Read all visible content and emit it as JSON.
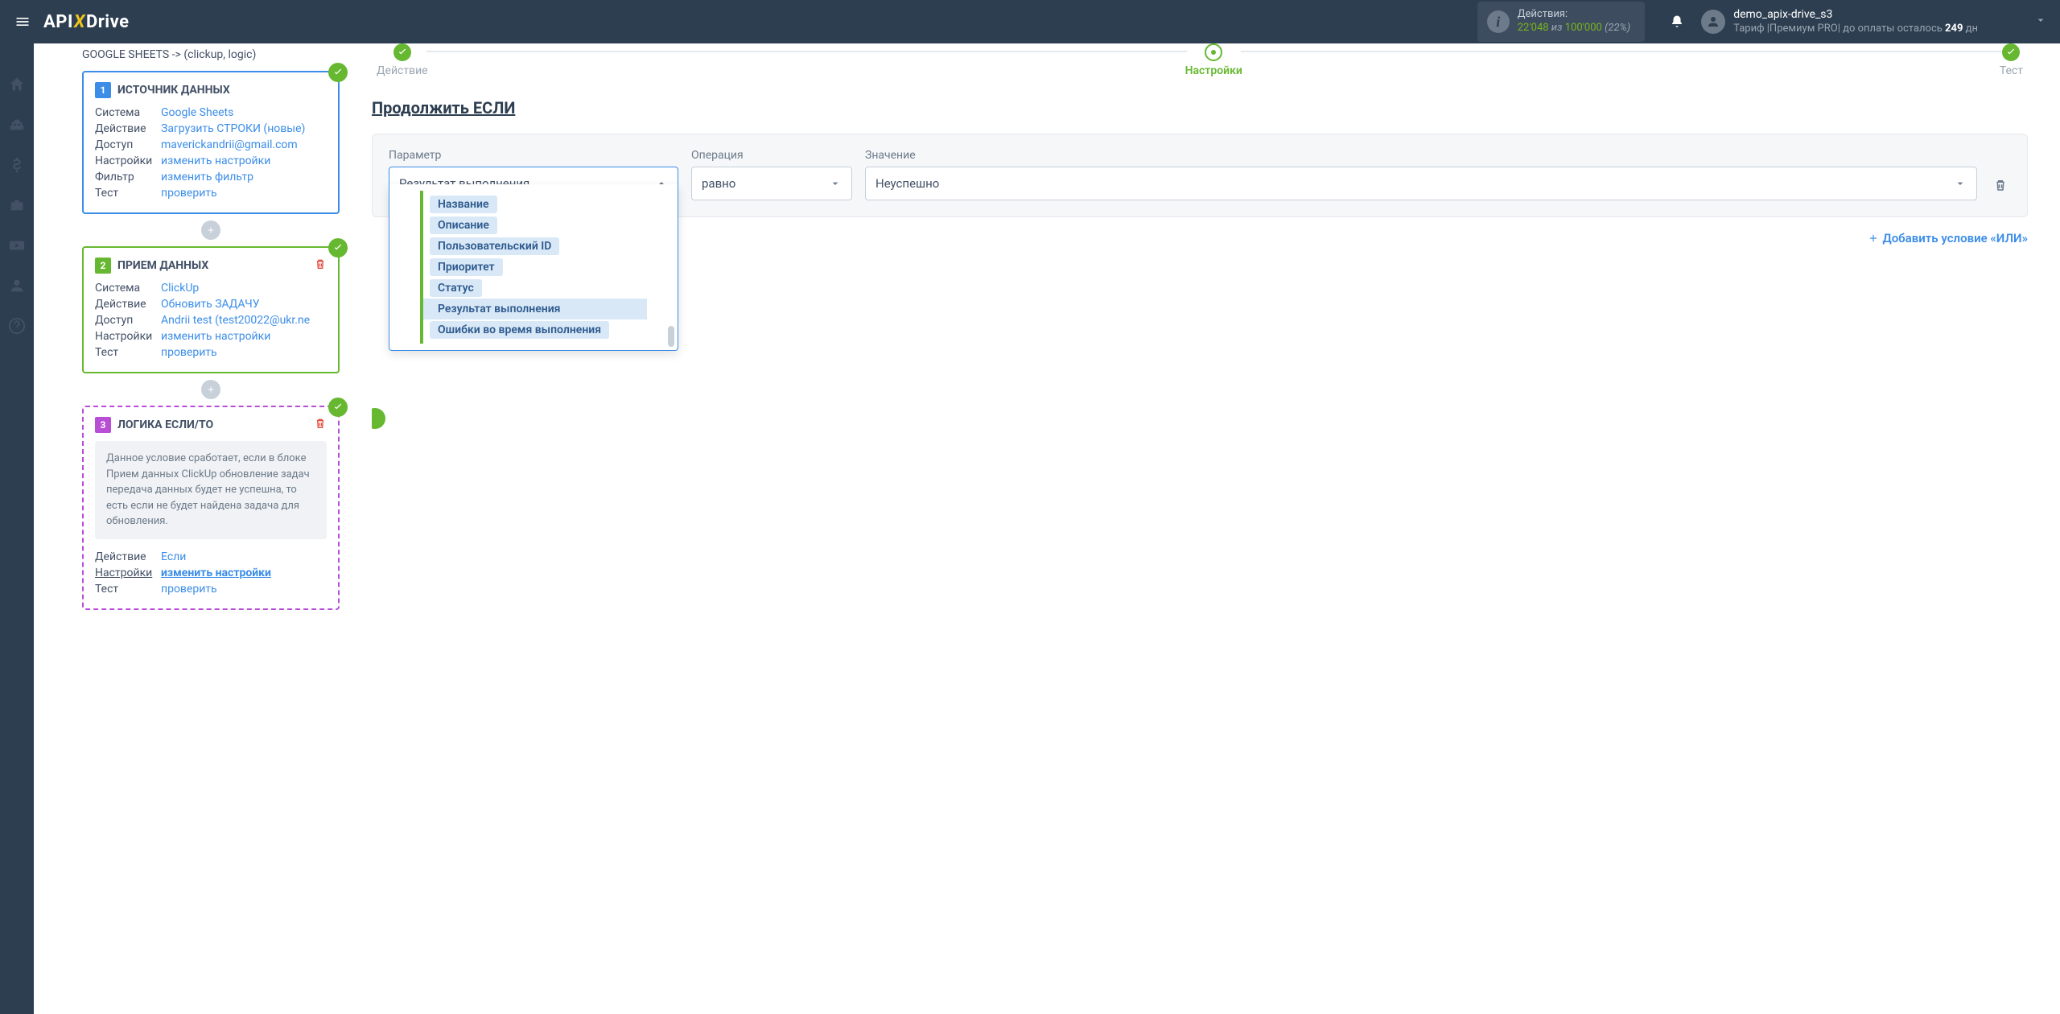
{
  "topbar": {
    "logo_pre": "API",
    "logo_x": "X",
    "logo_post": "Drive",
    "actions_label": "Действия:",
    "actions_used": "22'048",
    "actions_of": "из",
    "actions_total": "100'000",
    "actions_pct": "(22%)",
    "username": "demo_apix-drive_s3",
    "plan_pre": "Тариф |Премиум PRO| до оплаты осталось ",
    "plan_days": "249",
    "plan_suffix": " дн"
  },
  "flow": {
    "title": "GOOGLE SHEETS -> (clickup, logic)",
    "block1": {
      "heading": "ИСТОЧНИК ДАННЫХ",
      "rows": {
        "system_lbl": "Система",
        "system_val": "Google Sheets",
        "action_lbl": "Действие",
        "action_val": "Загрузить СТРОКИ (новые)",
        "access_lbl": "Доступ",
        "access_val": "maverickandrii@gmail.com",
        "settings_lbl": "Настройки",
        "settings_val": "изменить настройки",
        "filter_lbl": "Фильтр",
        "filter_val": "изменить фильтр",
        "test_lbl": "Тест",
        "test_val": "проверить"
      }
    },
    "block2": {
      "heading": "ПРИЕМ ДАННЫХ",
      "rows": {
        "system_lbl": "Система",
        "system_val": "ClickUp",
        "action_lbl": "Действие",
        "action_val": "Обновить ЗАДАЧУ",
        "access_lbl": "Доступ",
        "access_val": "Andrii test (test20022@ukr.ne",
        "settings_lbl": "Настройки",
        "settings_val": "изменить настройки",
        "test_lbl": "Тест",
        "test_val": "проверить"
      }
    },
    "block3": {
      "heading": "ЛОГИКА ЕСЛИ/ТО",
      "info": "Данное условие сработает, если в блоке Прием данных ClickUp обновление задач передача данных будет не успешна, то есть если не будет найдена задача для обновления.",
      "rows": {
        "action_lbl": "Действие",
        "action_val": "Если",
        "settings_lbl": "Настройки",
        "settings_val": "изменить настройки",
        "test_lbl": "Тест",
        "test_val": "проверить"
      }
    }
  },
  "steps": {
    "step1": "Действие",
    "step2": "Настройки",
    "step3": "Тест"
  },
  "main": {
    "title": "Продолжить ЕСЛИ",
    "param_label": "Параметр",
    "op_label": "Операция",
    "val_label": "Значение",
    "param_value": "Результат выполнения",
    "op_value": "равно",
    "val_value": "Неуспешно",
    "add_or": "Добавить условие «ИЛИ»",
    "options": [
      "Название",
      "Описание",
      "Пользовательский ID",
      "Приоритет",
      "Статус",
      "Результат выполнения",
      "Ошибки во время выполнения"
    ]
  }
}
